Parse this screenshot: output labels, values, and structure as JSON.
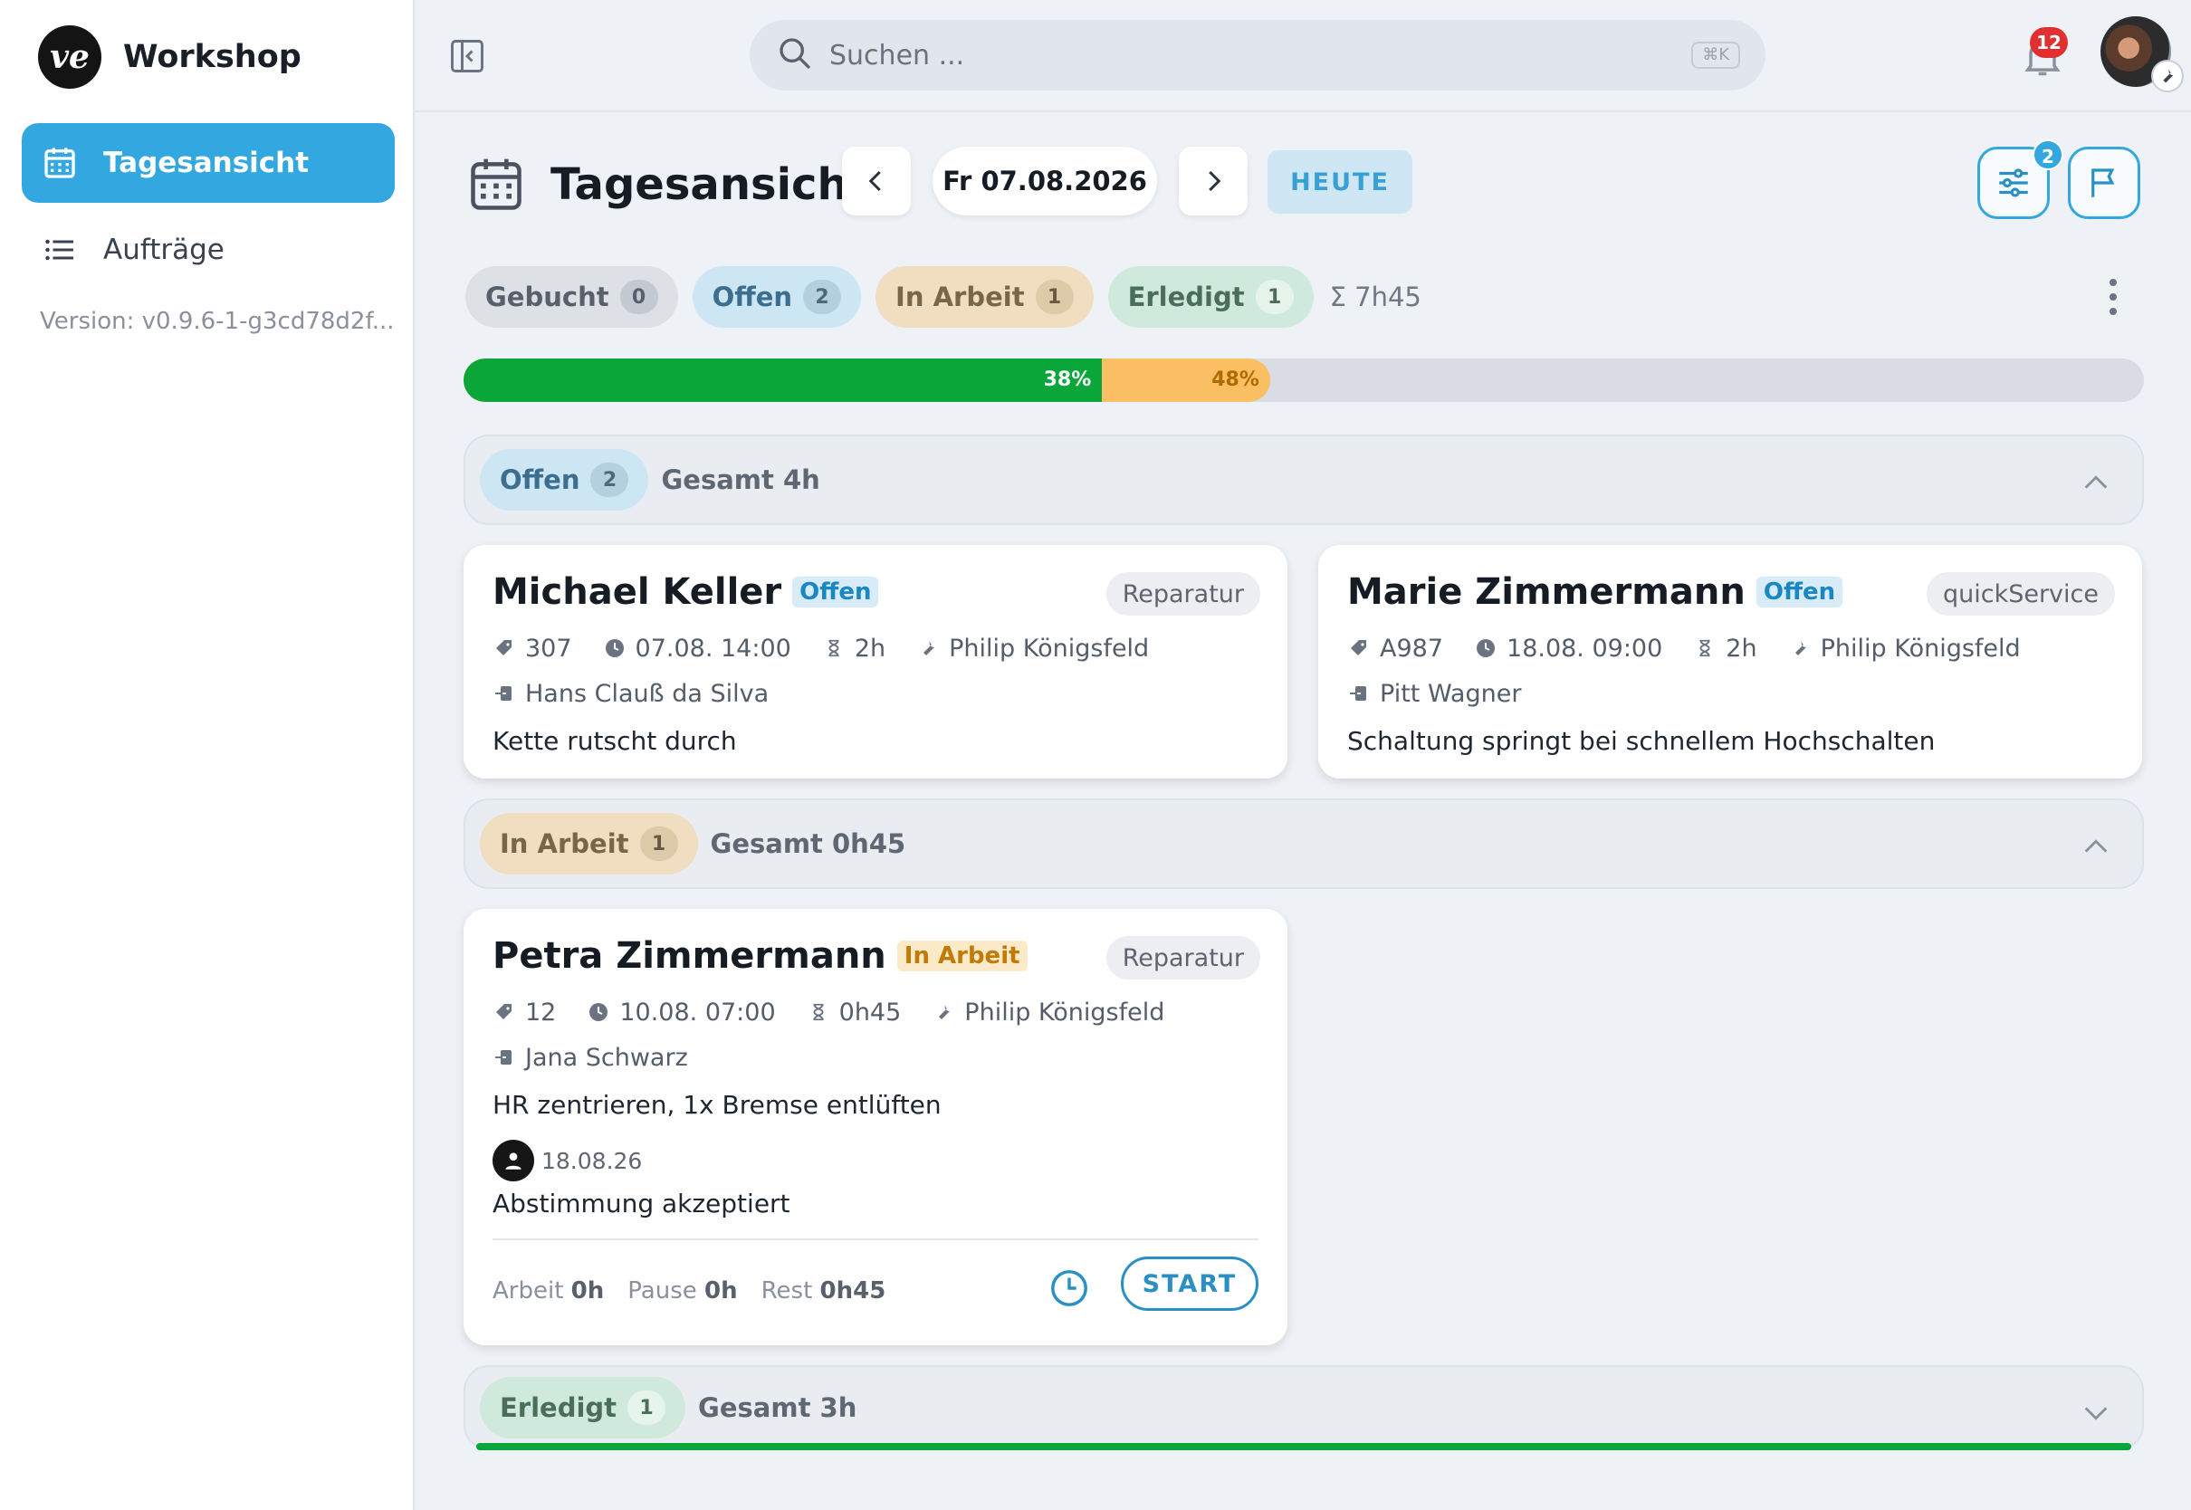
{
  "app": {
    "name": "Workshop",
    "logo_text": "ve",
    "version": "Version: v0.9.6-1-g3cd78d2f..."
  },
  "sidebar": {
    "items": [
      {
        "label": "Tagesansicht",
        "icon": "calendar-icon",
        "active": true
      },
      {
        "label": "Aufträge",
        "icon": "list-icon",
        "active": false
      }
    ]
  },
  "topbar": {
    "search_placeholder": "Suchen ...",
    "search_shortcut": "⌘K",
    "notifications_count": "12"
  },
  "header": {
    "title": "Tagesansicht",
    "date": "Fr 07.08.2026",
    "today_label": "HEUTE",
    "filter_badge": "2"
  },
  "status_chips": [
    {
      "label": "Gebucht",
      "count": "0"
    },
    {
      "label": "Offen",
      "count": "2"
    },
    {
      "label": "In Arbeit",
      "count": "1"
    },
    {
      "label": "Erledigt",
      "count": "1"
    }
  ],
  "total_time": "Σ 7h45",
  "progress": {
    "done_percent": 38,
    "done_label": "38%",
    "work_percent": 48,
    "work_label": "48%",
    "colors": {
      "done": "#0aa63a",
      "work": "#fbbf63"
    }
  },
  "sections": [
    {
      "label": "Offen",
      "count": "2",
      "total": "Gesamt 4h",
      "expanded": true
    },
    {
      "label": "In Arbeit",
      "count": "1",
      "total": "Gesamt 0h45",
      "expanded": true
    },
    {
      "label": "Erledigt",
      "count": "1",
      "total": "Gesamt 3h",
      "expanded": false
    }
  ],
  "cards": [
    {
      "name": "Michael Keller",
      "status": "Offen",
      "type": "Reparatur",
      "number": "307",
      "datetime": "07.08. 14:00",
      "duration": "2h",
      "mechanic": "Philip Königsfeld",
      "customer": "Hans Clauß da Silva",
      "description": "Kette rutscht durch"
    },
    {
      "name": "Marie Zimmermann",
      "status": "Offen",
      "type": "quickService",
      "number": "A987",
      "datetime": "18.08. 09:00",
      "duration": "2h",
      "mechanic": "Philip Königsfeld",
      "customer": "Pitt Wagner",
      "description": "Schaltung springt bei schnellem Hochschalten"
    },
    {
      "name": "Petra Zimmermann",
      "status": "In Arbeit",
      "type": "Reparatur",
      "number": "12",
      "datetime": "10.08. 07:00",
      "duration": "0h45",
      "mechanic": "Philip Königsfeld",
      "customer": "Jana Schwarz",
      "description": "HR zentrieren, 1x Bremse entlüften",
      "note_date": "18.08.26",
      "note_text": "Abstimmung akzeptiert",
      "footer": {
        "work_label": "Arbeit",
        "work_value": "0h",
        "pause_label": "Pause",
        "pause_value": "0h",
        "rest_label": "Rest",
        "rest_value": "0h45",
        "start_label": "START"
      }
    }
  ]
}
